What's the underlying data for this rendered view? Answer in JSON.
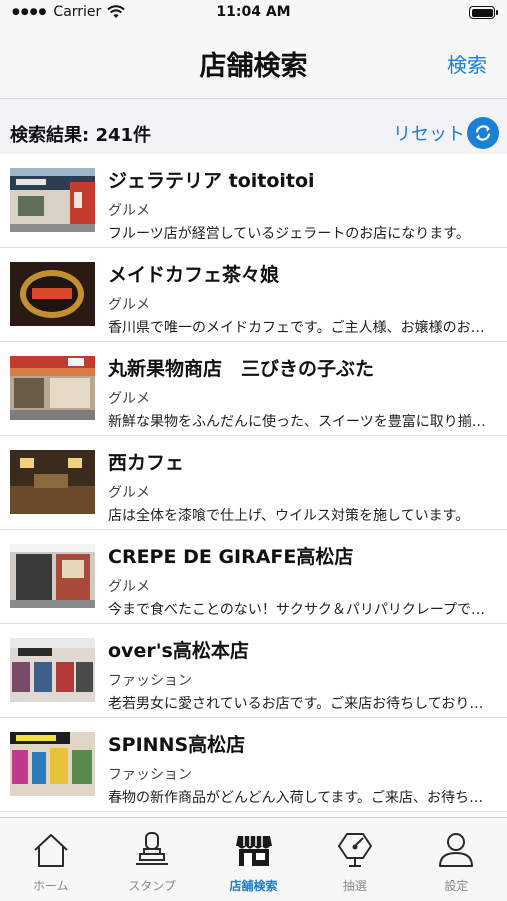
{
  "status_bar": {
    "carrier": "Carrier",
    "time": "11:04 AM"
  },
  "nav": {
    "title": "店舗検索",
    "search_label": "検索"
  },
  "results": {
    "count_text": "検索結果: 241件",
    "reset_label": "リセット"
  },
  "shops": [
    {
      "name": "ジェラテリア toitoitoi",
      "category": "グルメ",
      "description": "フルーツ店が経営しているジェラートのお店になります。"
    },
    {
      "name": "メイドカフェ茶々娘",
      "category": "グルメ",
      "description": "香川県で唯一のメイドカフェです。ご主人様、お嬢様のお帰りをお待ちしております。"
    },
    {
      "name": "丸新果物商店　三びきの子ぶた",
      "category": "グルメ",
      "description": "新鮮な果物をふんだんに使った、スイーツを豊富に取り揃えております。"
    },
    {
      "name": "西カフェ",
      "category": "グルメ",
      "description": "店は全体を漆喰で仕上げ、ウイルス対策を施しています。"
    },
    {
      "name": "CREPE DE GIRAFE高松店",
      "category": "グルメ",
      "description": "今まで食べたことのない！サクサク＆パリパリクレープです。"
    },
    {
      "name": "over's高松本店",
      "category": "ファッション",
      "description": "老若男女に愛されているお店です。ご来店お待ちしております。"
    },
    {
      "name": "SPINNS高松店",
      "category": "ファッション",
      "description": "春物の新作商品がどんどん入荷してます。ご来店、お待ちしております。"
    }
  ],
  "tabs": [
    {
      "label": "ホーム",
      "icon": "home-icon"
    },
    {
      "label": "スタンプ",
      "icon": "stamp-icon"
    },
    {
      "label": "店舗検索",
      "icon": "shop-icon"
    },
    {
      "label": "抽選",
      "icon": "lottery-icon"
    },
    {
      "label": "設定",
      "icon": "user-icon"
    }
  ],
  "colors": {
    "accent": "#1a7fd6",
    "inactive_tab": "#8a8a8a",
    "background": "#f2f2f7"
  }
}
